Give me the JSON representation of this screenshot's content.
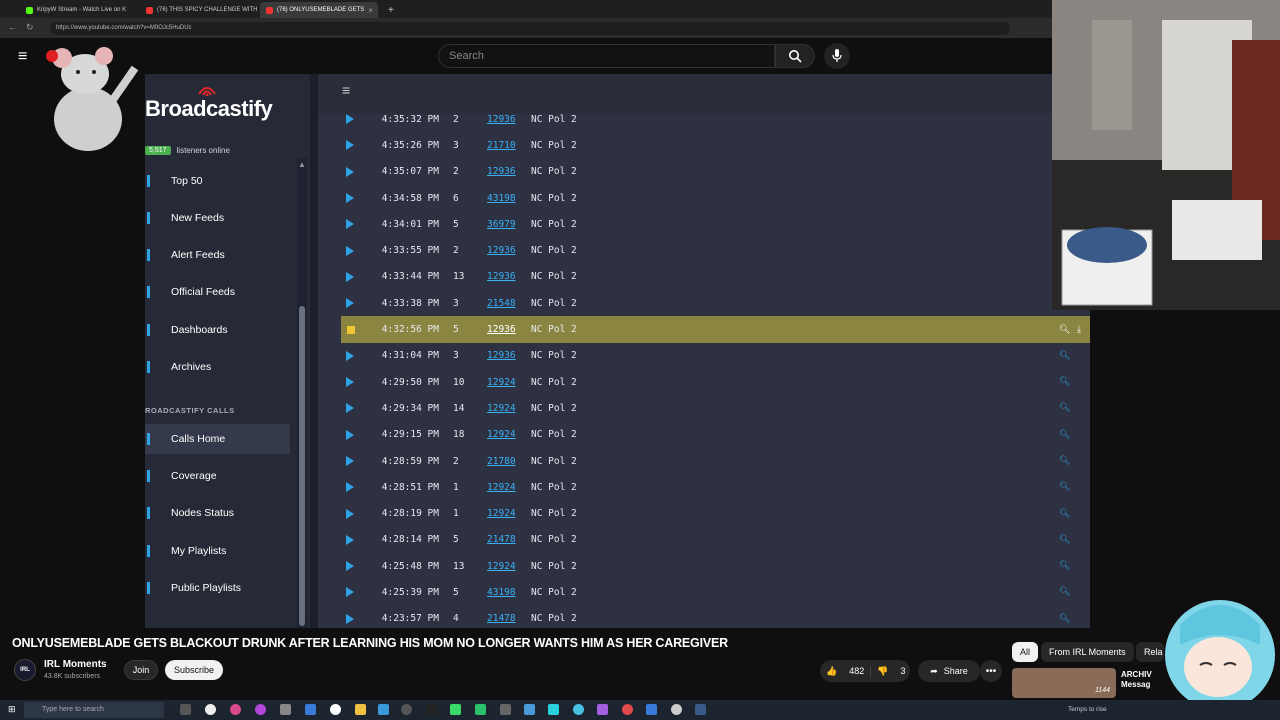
{
  "browser": {
    "tabs": [
      {
        "title": "KripyW Stream - Watch Live on K",
        "active": false
      },
      {
        "title": "(76) THIS SPICY CHALLENGE WITH",
        "active": false
      },
      {
        "title": "(76) ONLYUSEMEBLADE GETS",
        "active": true
      }
    ],
    "url": "https://www.youtube.com/watch?v=M0OJc5HuDUc"
  },
  "youtube": {
    "search_placeholder": "Search",
    "logo_fragment": "e"
  },
  "broadcastify": {
    "logo": "Broadcastify",
    "listeners_count": "5,517",
    "listeners_label": "listeners online",
    "nav": [
      {
        "label": "Top 50"
      },
      {
        "label": "New Feeds"
      },
      {
        "label": "Alert Feeds"
      },
      {
        "label": "Official Feeds"
      },
      {
        "label": "Dashboards"
      },
      {
        "label": "Archives"
      }
    ],
    "section_label": "ROADCASTIFY CALLS",
    "nav2": [
      {
        "label": "Calls Home",
        "active": true
      },
      {
        "label": "Coverage"
      },
      {
        "label": "Nodes Status"
      },
      {
        "label": "My Playlists"
      },
      {
        "label": "Public Playlists"
      }
    ],
    "calls": [
      {
        "time": "4:35:32 PM",
        "units": "2",
        "tg": "12936",
        "feed": "NC Pol 2",
        "state": "play"
      },
      {
        "time": "4:35:26 PM",
        "units": "3",
        "tg": "21710",
        "feed": "NC Pol 2",
        "state": "play"
      },
      {
        "time": "4:35:07 PM",
        "units": "2",
        "tg": "12936",
        "feed": "NC Pol 2",
        "state": "play"
      },
      {
        "time": "4:34:58 PM",
        "units": "6",
        "tg": "43198",
        "feed": "NC Pol 2",
        "state": "play"
      },
      {
        "time": "4:34:01 PM",
        "units": "5",
        "tg": "36979",
        "feed": "NC Pol 2",
        "state": "play"
      },
      {
        "time": "4:33:55 PM",
        "units": "2",
        "tg": "12936",
        "feed": "NC Pol 2",
        "state": "play"
      },
      {
        "time": "4:33:44 PM",
        "units": "13",
        "tg": "12936",
        "feed": "NC Pol 2",
        "state": "play"
      },
      {
        "time": "4:33:38 PM",
        "units": "3",
        "tg": "21548",
        "feed": "NC Pol 2",
        "state": "play"
      },
      {
        "time": "4:32:56 PM",
        "units": "5",
        "tg": "12936",
        "feed": "NC Pol 2",
        "state": "playing"
      },
      {
        "time": "4:31:04 PM",
        "units": "3",
        "tg": "12936",
        "feed": "NC Pol 2",
        "state": "play"
      },
      {
        "time": "4:29:50 PM",
        "units": "10",
        "tg": "12924",
        "feed": "NC Pol 2",
        "state": "play"
      },
      {
        "time": "4:29:34 PM",
        "units": "14",
        "tg": "12924",
        "feed": "NC Pol 2",
        "state": "play"
      },
      {
        "time": "4:29:15 PM",
        "units": "18",
        "tg": "12924",
        "feed": "NC Pol 2",
        "state": "play"
      },
      {
        "time": "4:28:59 PM",
        "units": "2",
        "tg": "21780",
        "feed": "NC Pol 2",
        "state": "play"
      },
      {
        "time": "4:28:51 PM",
        "units": "1",
        "tg": "12924",
        "feed": "NC Pol 2",
        "state": "play"
      },
      {
        "time": "4:28:19 PM",
        "units": "1",
        "tg": "12924",
        "feed": "NC Pol 2",
        "state": "play"
      },
      {
        "time": "4:28:14 PM",
        "units": "5",
        "tg": "21478",
        "feed": "NC Pol 2",
        "state": "play"
      },
      {
        "time": "4:25:48 PM",
        "units": "13",
        "tg": "12924",
        "feed": "NC Pol 2",
        "state": "play"
      },
      {
        "time": "4:25:39 PM",
        "units": "5",
        "tg": "43198",
        "feed": "NC Pol 2",
        "state": "play"
      },
      {
        "time": "4:23:57 PM",
        "units": "4",
        "tg": "21478",
        "feed": "NC Pol 2",
        "state": "play"
      }
    ]
  },
  "video": {
    "title": "ONLYUSEMEBLADE GETS BLACKOUT DRUNK AFTER LEARNING HIS MOM NO LONGER WANTS HIM AS HER CAREGIVER",
    "channel": "IRL Moments",
    "subscribers": "43.8K subscribers",
    "join": "Join",
    "subscribe": "Subscribe",
    "likes": "482",
    "dislikes": "3",
    "share": "Share",
    "chips": [
      "All",
      "From IRL Moments",
      "Rela"
    ],
    "related_title_1": "ARCHIV",
    "related_title_2": "Messag",
    "related_thumb_text": "1144"
  },
  "taskbar": {
    "search_placeholder": "Type here to search",
    "status": "Temps to rise"
  }
}
